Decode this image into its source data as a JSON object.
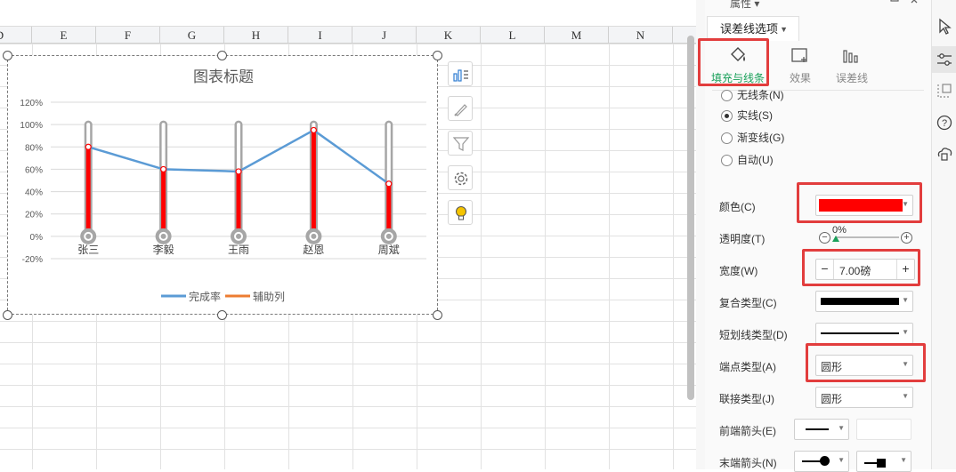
{
  "spreadsheet": {
    "columns": [
      "D",
      "E",
      "F",
      "G",
      "H",
      "I",
      "J",
      "K",
      "L",
      "M",
      "N"
    ]
  },
  "chart_data": {
    "type": "line",
    "title": "图表标题",
    "categories": [
      "张三",
      "李毅",
      "王雨",
      "赵恩",
      "周斌"
    ],
    "series": [
      {
        "name": "完成率",
        "values": [
          0.8,
          0.6,
          0.58,
          0.95,
          0.47
        ],
        "color": "#5b9bd5"
      },
      {
        "name": "辅助列",
        "values": [
          1.0,
          1.0,
          1.0,
          1.0,
          1.0
        ],
        "color": "#ed7d31"
      }
    ],
    "y_ticks": [
      "120%",
      "100%",
      "80%",
      "60%",
      "40%",
      "20%",
      "0%",
      "-20%"
    ],
    "ylim": [
      -0.2,
      1.2
    ],
    "error_bar_color": "#ff0000",
    "thermometer_tube_color": "#a6a6a6",
    "grid": true,
    "legend_position": "bottom"
  },
  "chart_tools": [
    "chart-elements-icon",
    "chart-style-icon",
    "chart-filter-icon",
    "chart-settings-icon",
    "chart-idea-icon"
  ],
  "panel": {
    "title": "属性 ▾",
    "option_dropdown": "误差线选项",
    "tabs": [
      {
        "label": "填充与线条",
        "icon": "fill-bucket-icon",
        "active": true
      },
      {
        "label": "效果",
        "icon": "effects-icon",
        "active": false
      },
      {
        "label": "误差线",
        "icon": "error-bar-icon",
        "active": false
      }
    ],
    "line_options": [
      {
        "label": "无线条(N)",
        "checked": false
      },
      {
        "label": "实线(S)",
        "checked": true
      },
      {
        "label": "渐变线(G)",
        "checked": false
      },
      {
        "label": "自动(U)",
        "checked": false
      }
    ],
    "color_label": "颜色(C)",
    "color_value": "#ff0000",
    "transparency_label": "透明度(T)",
    "transparency_value": "0%",
    "width_label": "宽度(W)",
    "width_value": "7.00磅",
    "compound_label": "复合类型(C)",
    "dash_label": "短划线类型(D)",
    "cap_label": "端点类型(A)",
    "cap_value": "圆形",
    "join_label": "联接类型(J)",
    "join_value": "圆形",
    "begin_arrow_label": "前端箭头(E)",
    "end_arrow_label": "末端箭头(N)"
  }
}
